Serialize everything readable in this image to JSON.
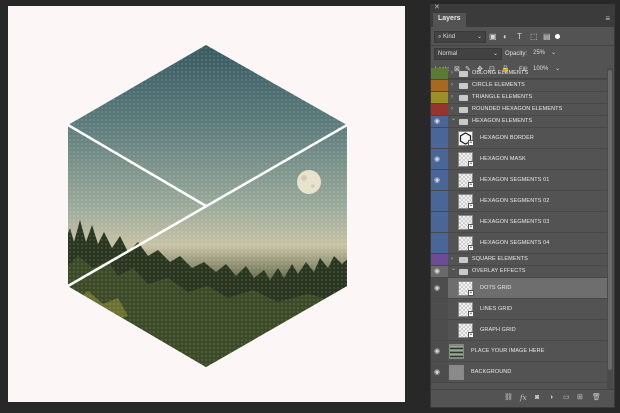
{
  "panel": {
    "tab": "Layers",
    "filter_kind": "Kind",
    "blend_mode": "Normal",
    "opacity_label": "Opacity:",
    "opacity_value": "25%",
    "lock_label": "Lock:",
    "fill_label": "Fill:",
    "fill_value": "100%"
  },
  "colors": {
    "green": "#5b7a35",
    "orange": "#a7691f",
    "yellow": "#9e8f25",
    "red": "#96352e",
    "blue": "#4a6598",
    "violet": "#6d4b96",
    "gray": "#6a6a6a",
    "canvas_bg": "#fcf6f6"
  },
  "layers": [
    {
      "name": "OBLONG ELEMENTS",
      "type": "group",
      "visible": false,
      "color": "green",
      "expanded": false
    },
    {
      "name": "CIRCLE ELEMENTS",
      "type": "group",
      "visible": false,
      "color": "orange",
      "expanded": false
    },
    {
      "name": "TRIANGLE ELEMENTS",
      "type": "group",
      "visible": false,
      "color": "yellow",
      "expanded": false
    },
    {
      "name": "ROUNDED HEXAGON ELEMENTS",
      "type": "group",
      "visible": false,
      "color": "red",
      "expanded": false
    },
    {
      "name": "HEXAGON ELEMENTS",
      "type": "group",
      "visible": true,
      "color": "blue",
      "expanded": true
    },
    {
      "name": "HEXAGON BORDER",
      "type": "smart",
      "visible": false,
      "color": "blue",
      "icon": "hexagon-outline"
    },
    {
      "name": "HEXAGON MASK",
      "type": "smart",
      "visible": true,
      "color": "blue"
    },
    {
      "name": "HEXAGON SEGMENTS 01",
      "type": "smart",
      "visible": true,
      "color": "blue"
    },
    {
      "name": "HEXAGON SEGMENTS 02",
      "type": "smart",
      "visible": false,
      "color": "blue"
    },
    {
      "name": "HEXAGON SEGMENTS 03",
      "type": "smart",
      "visible": false,
      "color": "blue"
    },
    {
      "name": "HEXAGON SEGMENTS 04",
      "type": "smart",
      "visible": false,
      "color": "blue"
    },
    {
      "name": "SQUARE ELEMENTS",
      "type": "group",
      "visible": false,
      "color": "violet",
      "expanded": false
    },
    {
      "name": "OVERLAY EFFECTS",
      "type": "group",
      "visible": true,
      "color": "gray",
      "expanded": true
    },
    {
      "name": "DOTS GRID",
      "type": "smart",
      "visible": true,
      "color": "none",
      "selected": true
    },
    {
      "name": "LINES GRID",
      "type": "smart",
      "visible": false,
      "color": "none"
    },
    {
      "name": "GRAPH GRID",
      "type": "smart",
      "visible": false,
      "color": "none"
    },
    {
      "name": "PLACE YOUR  IMAGE HERE",
      "type": "image",
      "visible": true,
      "color": "none"
    },
    {
      "name": "BACKGROUND",
      "type": "fill",
      "visible": true,
      "color": "none"
    }
  ],
  "bottom_icons": [
    "link-icon",
    "fx-icon",
    "mask-icon",
    "adjustment-icon",
    "new-group-icon",
    "new-layer-icon",
    "trash-icon"
  ]
}
